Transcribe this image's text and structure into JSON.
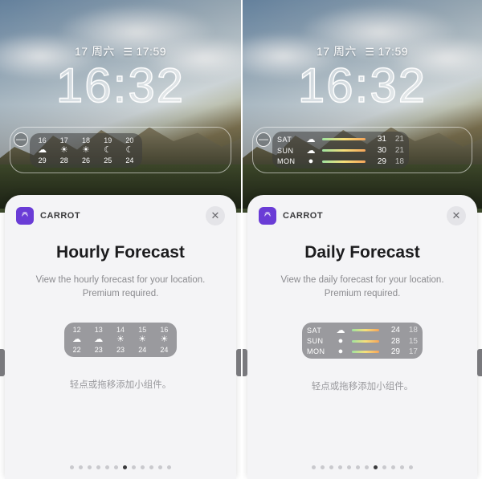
{
  "left": {
    "date_day": "17",
    "date_weekday": "周六",
    "sunset_icon": "☰",
    "sunset_time": "17:59",
    "clock": "16:32",
    "remove_icon": "—",
    "hourly": [
      {
        "h": "16",
        "icon": "☁",
        "t": "29"
      },
      {
        "h": "17",
        "icon": "☀",
        "t": "28"
      },
      {
        "h": "18",
        "icon": "☀",
        "t": "26"
      },
      {
        "h": "19",
        "icon": "☾",
        "t": "25"
      },
      {
        "h": "20",
        "icon": "☾",
        "t": "24"
      }
    ],
    "sheet": {
      "app": "CARROT",
      "close": "✕",
      "title": "Hourly Forecast",
      "desc_l1": "View the hourly forecast for your location.",
      "desc_l2": "Premium required.",
      "preview_hourly": [
        {
          "h": "12",
          "icon": "☁",
          "t": "22"
        },
        {
          "h": "13",
          "icon": "☁",
          "t": "23"
        },
        {
          "h": "14",
          "icon": "☀",
          "t": "23"
        },
        {
          "h": "15",
          "icon": "☀",
          "t": "24"
        },
        {
          "h": "16",
          "icon": "☀",
          "t": "24"
        }
      ],
      "hint": "轻点或拖移添加小组件。",
      "dots_total": 12,
      "dots_active": 6
    }
  },
  "right": {
    "date_day": "17",
    "date_weekday": "周六",
    "sunset_icon": "☰",
    "sunset_time": "17:59",
    "clock": "16:32",
    "remove_icon": "—",
    "daily": [
      {
        "d": "SAT",
        "icon": "☁",
        "hi": "31",
        "lo": "21"
      },
      {
        "d": "SUN",
        "icon": "☁",
        "hi": "30",
        "lo": "21"
      },
      {
        "d": "MON",
        "icon": "●",
        "hi": "29",
        "lo": "18"
      }
    ],
    "sheet": {
      "app": "CARROT",
      "close": "✕",
      "title": "Daily Forecast",
      "desc_l1": "View the daily forecast for your location.",
      "desc_l2": "Premium required.",
      "preview_daily": [
        {
          "d": "SAT",
          "icon": "☁",
          "hi": "24",
          "lo": "18"
        },
        {
          "d": "SUN",
          "icon": "●",
          "hi": "28",
          "lo": "15"
        },
        {
          "d": "MON",
          "icon": "●",
          "hi": "29",
          "lo": "17"
        }
      ],
      "hint": "轻点或拖移添加小组件。",
      "dots_total": 12,
      "dots_active": 7
    }
  }
}
